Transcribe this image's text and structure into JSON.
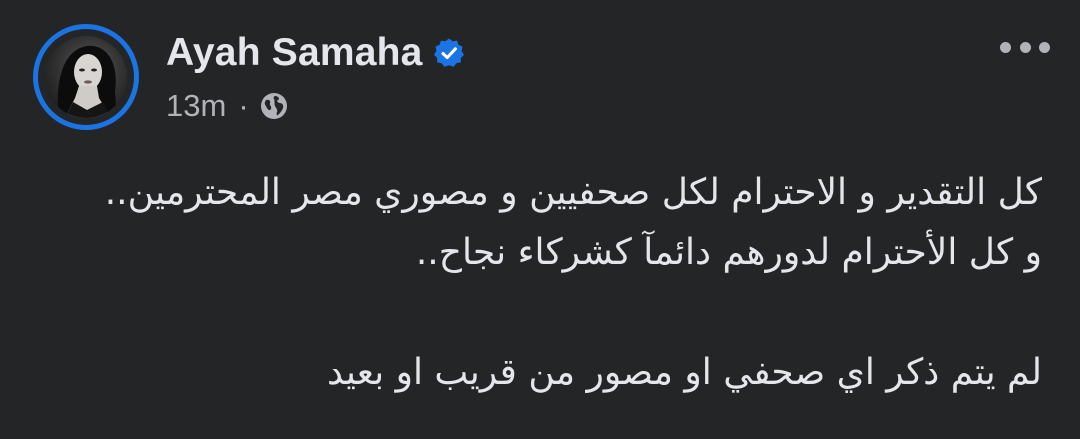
{
  "post": {
    "author": {
      "name": "Ayah Samaha",
      "verified_icon": "verified-badge-icon",
      "avatar_icon": "profile-avatar"
    },
    "meta": {
      "time": "13m",
      "separator": "·",
      "audience_icon": "globe-icon"
    },
    "menu_icon": "more-options-icon",
    "text": {
      "line1": "كل التقدير و الاحترام لكل صحفيين و مصوري مصر المحترمين..",
      "line2": "و كل الأحترام لدورهم دائمآ كشركاء نجاح..",
      "line3": "لم يتم ذكر اي صحفي او مصور من قريب او بعيد"
    }
  },
  "colors": {
    "background": "#242526",
    "primary_text": "#e4e6eb",
    "secondary_text": "#b0b3b8",
    "accent": "#1b74e4"
  }
}
